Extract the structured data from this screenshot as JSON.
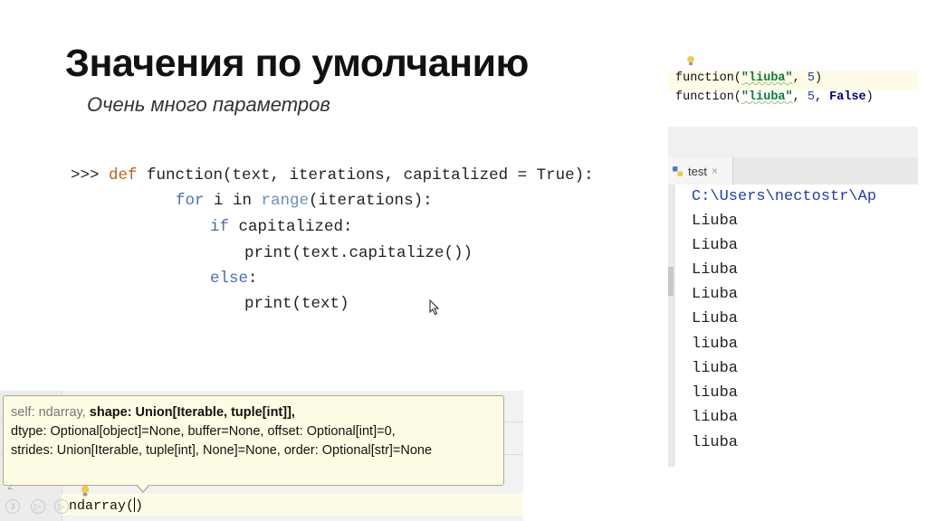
{
  "slide": {
    "title": "Значения по умолчанию",
    "subtitle": "Очень много параметров"
  },
  "code": {
    "prompt": ">>> ",
    "line1_kw": "def",
    "line1_rest": " function(text, iterations, capitalized = True):",
    "line2_kw": "for",
    "line2_mid": " i in ",
    "line2_builtin": "range",
    "line2_rest": "(iterations):",
    "line3_kw": "if",
    "line3_rest": " capitalized:",
    "line4": "print(text.capitalize())",
    "line5_kw": "else",
    "line5_rest": ":",
    "line6": "print(text)"
  },
  "snippet": {
    "l1_a": "function(",
    "l1_str": "\"liuba\"",
    "l1_b": ", ",
    "l1_num": "5",
    "l1_c": ")",
    "l2_a": "function(",
    "l2_str": "\"liuba\"",
    "l2_b": ", ",
    "l2_num": "5",
    "l2_c": ", ",
    "l2_kw": "False",
    "l2_d": ")"
  },
  "console": {
    "tab_label": "test",
    "tab_close": "×",
    "path": "C:\\Users\\nectostr\\Ap",
    "output": [
      "Liuba",
      "Liuba",
      "Liuba",
      "Liuba",
      "Liuba",
      "liuba",
      "liuba",
      "liuba",
      "liuba",
      "liuba"
    ]
  },
  "ide": {
    "gutter_num_a": "2",
    "gutter_num_b": "3",
    "line_text": "ndarray(",
    "line_close": ")"
  },
  "tooltip": {
    "p1_muted": "self: ndarray, ",
    "p1_bold": "shape: Union[Iterable, tuple[int]],",
    "p2": "dtype: Optional[object]=None, buffer=None, offset: Optional[int]=0,",
    "p3": "strides: Union[Iterable, tuple[int], None]=None, order: Optional[str]=None"
  },
  "colors": {
    "keyword": "#b5651d",
    "keyword_blue": "#4a6fa5",
    "string": "#0a7a3a",
    "number": "#1f3fae",
    "tooltip_bg": "#fefce4",
    "highlight_line": "#fefce6"
  },
  "icons": [
    "lightbulb-icon",
    "python-file-icon",
    "close-icon",
    "mouse-pointer-icon"
  ]
}
